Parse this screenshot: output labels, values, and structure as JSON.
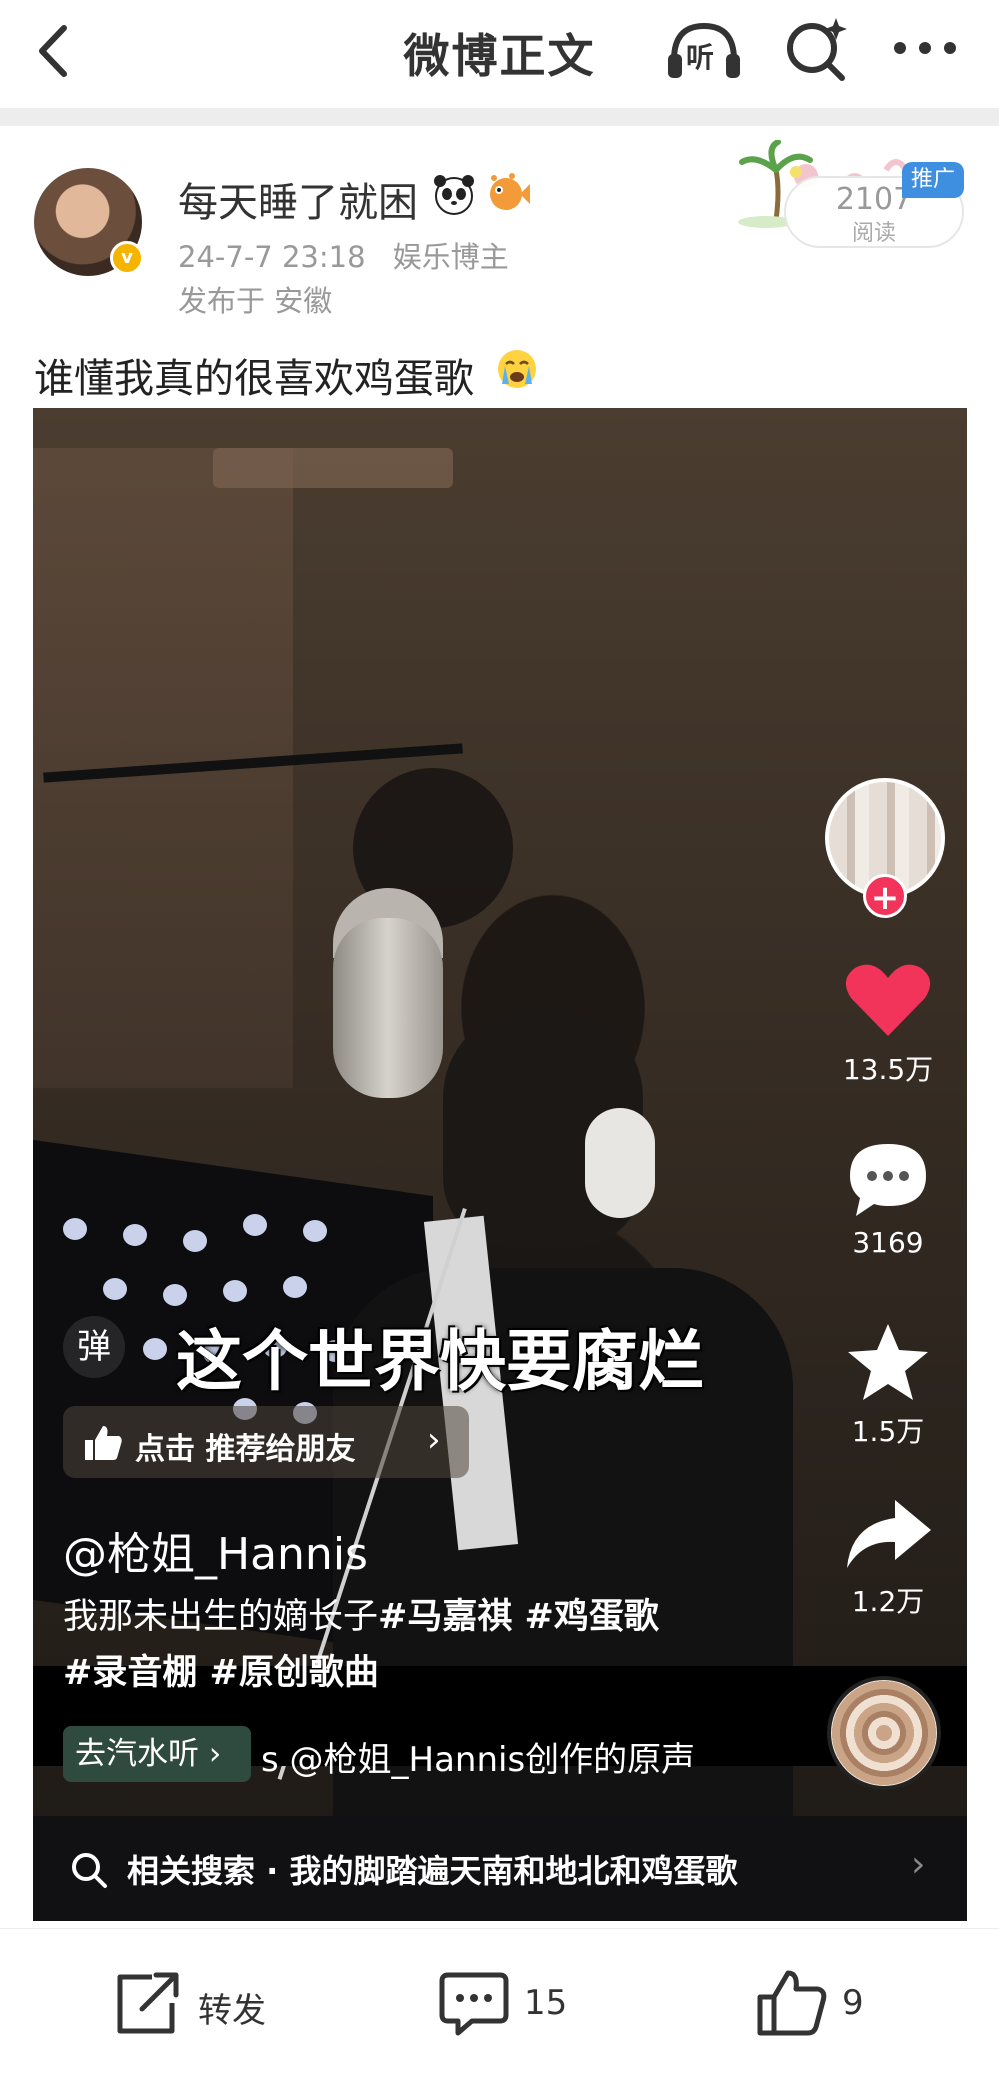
{
  "nav": {
    "title": "微博正文",
    "listen_label": "听"
  },
  "post": {
    "username": "每天睡了就困",
    "timestamp": "24-7-7 23:18",
    "user_tag": "娱乐博主",
    "location": "发布于 安徽",
    "read_count": "2107",
    "read_label": "阅读",
    "ad_label": "推广",
    "text": "谁懂我真的很喜欢鸡蛋歌"
  },
  "video": {
    "danmu_label": "弹",
    "subtitle": "这个世界快要腐烂",
    "recommend_label": "点击 推荐给朋友",
    "author": "@枪姐_Hannis",
    "description_line1": "我那未出生的嫡长子",
    "description_tags1": "#马嘉祺 #鸡蛋歌",
    "description_line2": "#录音棚 #原创歌曲",
    "likes": "13.5万",
    "comments": "3169",
    "favorites": "1.5万",
    "shares": "1.2万",
    "go_soda_label": "去汽水听",
    "music_title": "s    @枪姐_Hannis创作的原声",
    "related_search": "相关搜索 · 我的脚踏遍天南和地北和鸡蛋歌"
  },
  "bottom_bar": {
    "repost_label": "转发",
    "comment_count": "15",
    "like_count": "9"
  },
  "colors": {
    "like_red": "#f2335a",
    "ad_blue": "#3f8fe0",
    "verify_gold": "#f5b400"
  }
}
